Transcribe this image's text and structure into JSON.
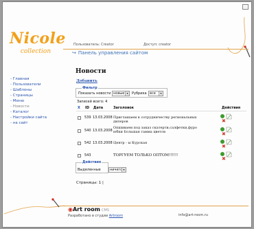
{
  "brand": {
    "logo": "Nicole",
    "logo_sub": "collection"
  },
  "user_bar": {
    "user_label": "Пользователь: Creator",
    "access_label": "Доступ: creator",
    "panel_title": "Панель управления сайтом"
  },
  "sidebar": {
    "items": [
      {
        "label": "- Главная"
      },
      {
        "label": "- Пользователи"
      },
      {
        "label": "- Шаблоны"
      },
      {
        "label": "- Страницы"
      },
      {
        "label": "- Меню"
      },
      {
        "label": "- Новости"
      },
      {
        "label": "- Каталог"
      },
      {
        "label": "- Настройки сайта"
      },
      {
        "label": "- на сайт"
      }
    ]
  },
  "main": {
    "title": "Новости",
    "add_link": "Добавить",
    "filter": {
      "legend": "Фильтр",
      "show_label": "Показать новости",
      "show_value": "новые",
      "rubric_label": "Рубрика",
      "rubric_value": "все"
    },
    "total": "Записей всего: 4",
    "table": {
      "headers": {
        "x": "X",
        "id": "ID",
        "date": "Дата",
        "title": "Заголовок",
        "actions": "Действия"
      },
      "rows": [
        {
          "id": "539",
          "date": "13.03.2008",
          "title": "Приглашаем к сотрудничеству региональных дилеров"
        },
        {
          "id": "540",
          "date": "13.03.2008",
          "title": "Опшиваем под заказ скатерти,салфетки,фуро юбки Большая гамма цветов"
        },
        {
          "id": "542",
          "date": "13.03.2008",
          "title": "Центр - ы Курская"
        },
        {
          "id": "543",
          "date": "",
          "title": "ТОРГУЕМ ТОЛЬКО ОПТОМ!!!!!!"
        }
      ]
    },
    "actions": {
      "legend": "Действия",
      "selected_label": "Выделенные",
      "selected_value": "ничего"
    },
    "pages": "Страницы: 1 |"
  },
  "footer": {
    "logo_text": "Art room",
    "logo_cms": "CMS",
    "dev_text": "Разработано в студии",
    "dev_link": "Artroom",
    "email": "info@art-room.ru"
  },
  "colors": {
    "accent": "#f2a01a",
    "link": "#2a55b0",
    "line": "#e3a24a"
  },
  "icons": {
    "edit": "edit-icon",
    "page": "page-icon",
    "delete": "delete-icon"
  }
}
